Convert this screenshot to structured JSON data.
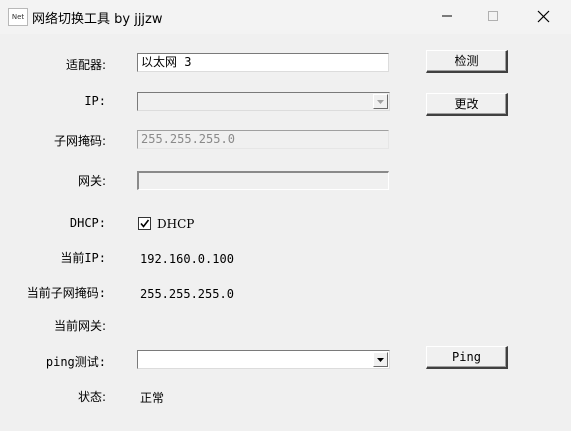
{
  "window": {
    "app_icon_text": "Net",
    "title": "网络切换工具 by jjjzw",
    "controls": [
      "minimize",
      "maximize",
      "close"
    ]
  },
  "form": {
    "adapter": {
      "label": "适配器:",
      "value": "以太网 3"
    },
    "ip": {
      "label": "IP:",
      "value": ""
    },
    "subnet": {
      "label": "子网掩码:",
      "value": "255.255.255.0"
    },
    "gateway": {
      "label": "网关:",
      "value": ""
    },
    "dhcp": {
      "label": "DHCP:",
      "checkbox_label": "DHCP",
      "checked": true
    },
    "current_ip": {
      "label": "当前IP:",
      "value": "192.160.0.100"
    },
    "current_subnet": {
      "label": "当前子网掩码:",
      "value": "255.255.255.0"
    },
    "current_gateway": {
      "label": "当前网关:",
      "value": ""
    },
    "ping": {
      "label": "ping测试:",
      "value": ""
    },
    "status": {
      "label": "状态:",
      "value": "正常"
    }
  },
  "buttons": {
    "detect": "检测",
    "change": "更改",
    "ping": "Ping"
  },
  "icons": {
    "minimize": "minimize-icon",
    "maximize": "maximize-icon",
    "close": "close-icon",
    "dropdown": "chevron-down-icon",
    "check": "check-icon"
  }
}
